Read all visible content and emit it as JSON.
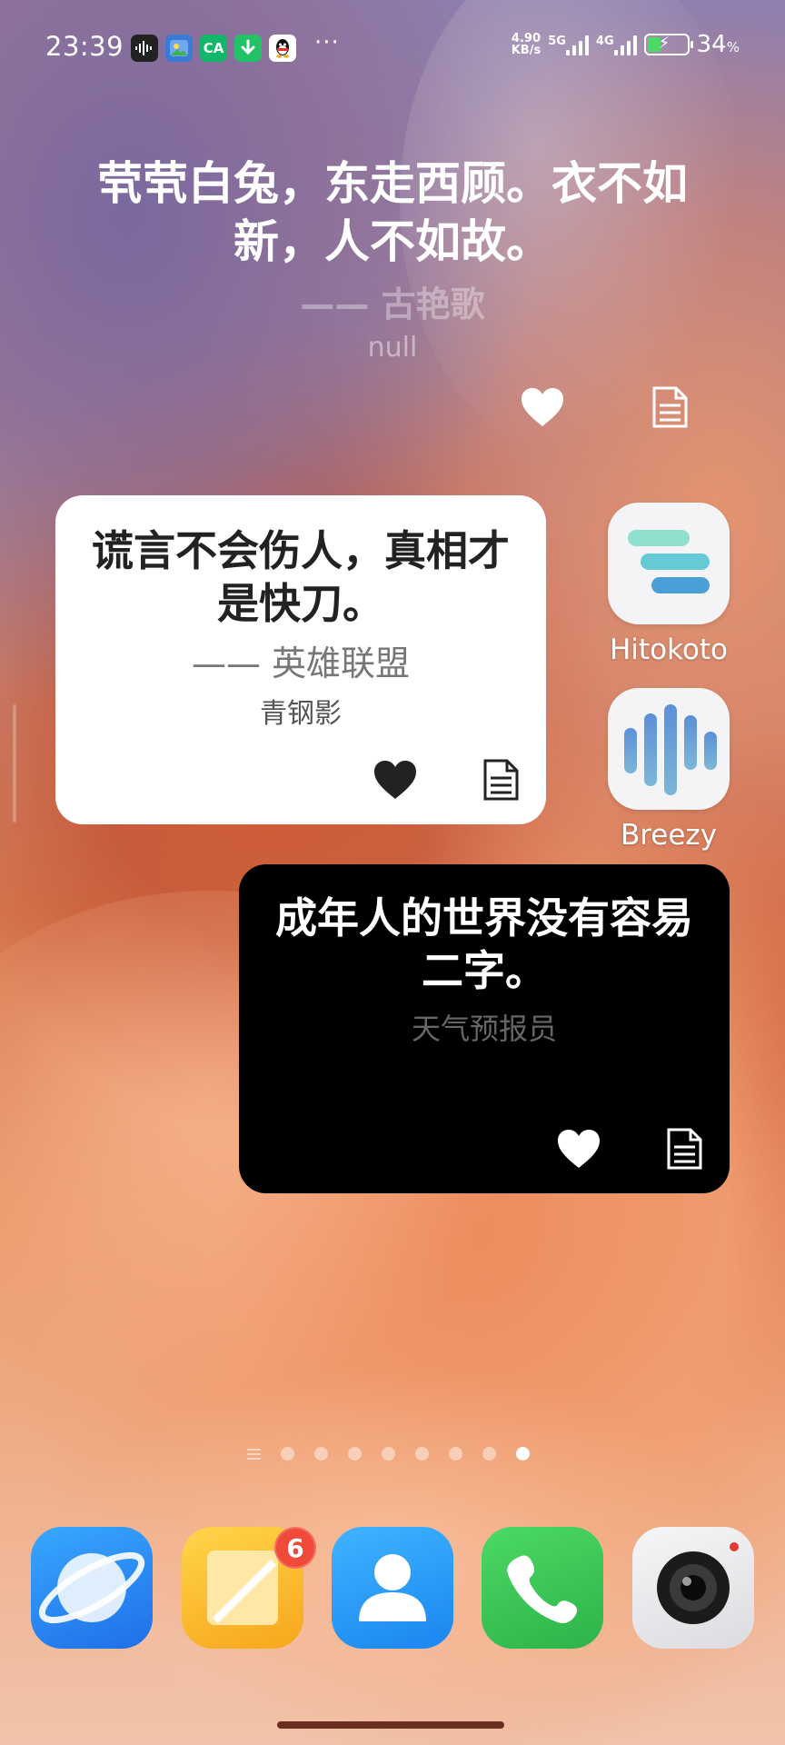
{
  "status_bar": {
    "time": "23:39",
    "more": "···",
    "speed_top": "4.90",
    "speed_bottom": "KB/s",
    "net1": "5G",
    "net2": "4G",
    "battery_percent": "34",
    "battery_unit": "%",
    "notification_icons": [
      "audio-recorder-icon",
      "photos-icon",
      "app-ca-icon",
      "download-icon",
      "qq-icon"
    ]
  },
  "widget_transparent": {
    "quote": "茕茕白兔，东走西顾。衣不如新，人不如故。",
    "from": "—— 古艳歌",
    "who": "null"
  },
  "widget_white": {
    "quote": "谎言不会伤人，真相才是快刀。",
    "from": "—— 英雄联盟",
    "who": "青钢影"
  },
  "widget_black": {
    "quote": "成年人的世界没有容易二字。",
    "who": "天气预报员"
  },
  "apps": {
    "hitokoto": "Hitokoto",
    "breezy": "Breezy"
  },
  "page_indicator": {
    "pages": 8,
    "current": 8
  },
  "dock": {
    "browser": "browser-icon",
    "notes": "notes-icon",
    "notes_badge": "6",
    "contacts": "contacts-icon",
    "phone": "phone-icon",
    "camera": "camera-icon"
  },
  "colors": {
    "heart_white": "#ffffff",
    "heart_dark": "#222222",
    "badge": "#f04a3a",
    "phone_green": "#37c24f",
    "browser_blue": "#2f8df5"
  }
}
